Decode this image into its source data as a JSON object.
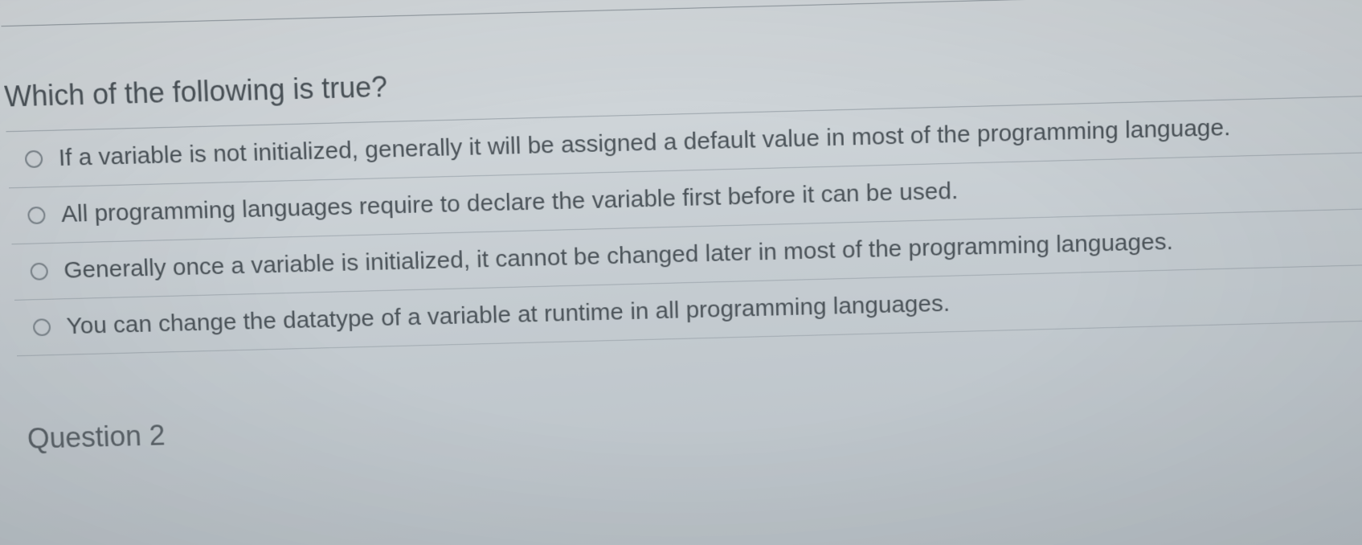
{
  "question": {
    "prompt": "Which of the following is true?",
    "options": [
      {
        "label": "If a variable is not initialized, generally it will be assigned a default value in most of the programming language."
      },
      {
        "label": "All programming languages require to declare the variable first before it can be used."
      },
      {
        "label": "Generally once a variable is initialized, it cannot be changed later in most of the programming languages."
      },
      {
        "label": "You can change the datatype of a variable at runtime in all programming languages."
      }
    ]
  },
  "next_heading": "Question 2"
}
